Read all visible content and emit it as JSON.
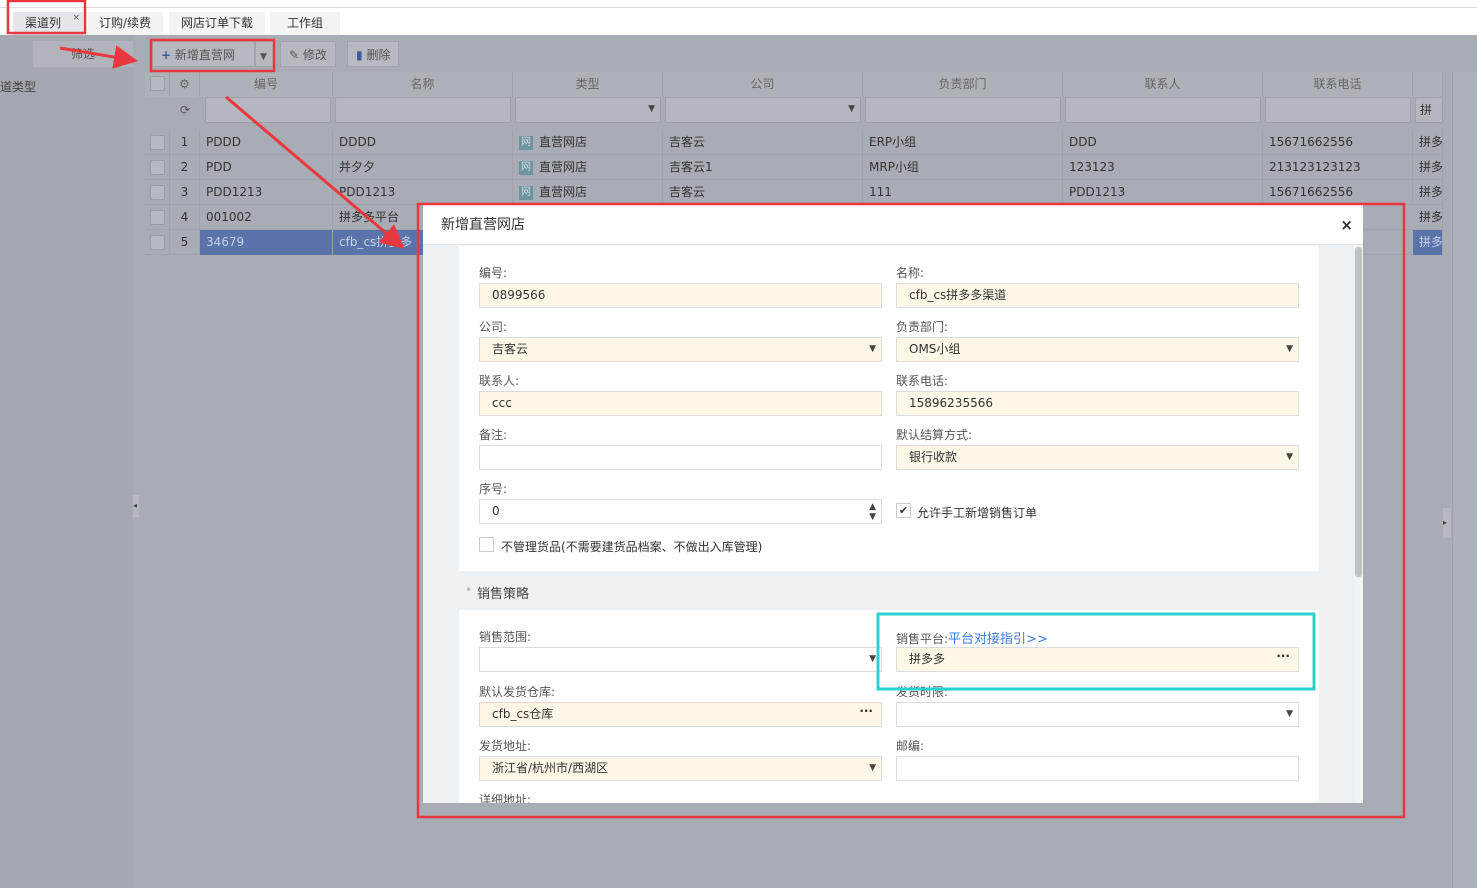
{
  "tabs": [
    {
      "label": "渠道列表",
      "close": "×"
    },
    {
      "label": "订购/续费"
    },
    {
      "label": "网店订单下载"
    },
    {
      "label": "工作组"
    }
  ],
  "sidebar": {
    "filter_button": "筛选",
    "type_label": "道类型"
  },
  "toolbar": {
    "add_label": "新增直营网店",
    "edit_label": "修改",
    "delete_label": "删除"
  },
  "grid": {
    "columns": [
      "编号",
      "名称",
      "类型",
      "公司",
      "负责部门",
      "联系人",
      "联系电话"
    ],
    "last_filter_value": "拼多",
    "rows": [
      {
        "no": "1",
        "code": "PDDD",
        "name": "DDDD",
        "type": "直营网店",
        "company": "吉客云",
        "dept": "ERP小组",
        "contact": "DDD",
        "phone": "15671662556",
        "platform": "拼多"
      },
      {
        "no": "2",
        "code": "PDD",
        "name": "并夕夕",
        "type": "直营网店",
        "company": "吉客云1",
        "dept": "MRP小组",
        "contact": "123123",
        "phone": "213123123123",
        "platform": "拼多"
      },
      {
        "no": "3",
        "code": "PDD1213",
        "name": "PDD1213",
        "type": "直营网店",
        "company": "吉客云",
        "dept": "111",
        "contact": "PDD1213",
        "phone": "15671662556",
        "platform": "拼多"
      },
      {
        "no": "4",
        "code": "001002",
        "name": "拼多多平台",
        "platform": "拼多"
      },
      {
        "no": "5",
        "code": "34679",
        "name": "cfb_cs拼多多",
        "platform": "拼多",
        "selected": true
      }
    ],
    "type_badge": "网"
  },
  "modal": {
    "title": "新增直营网店",
    "close": "×",
    "fields": {
      "code_label": "编号:",
      "code_value": "0899566",
      "name_label": "名称:",
      "name_value": "cfb_cs拼多多渠道",
      "company_label": "公司:",
      "company_value": "吉客云",
      "dept_label": "负责部门:",
      "dept_value": "OMS小组",
      "contact_label": "联系人:",
      "contact_value": "ccc",
      "phone_label": "联系电话:",
      "phone_value": "15896235566",
      "remark_label": "备注:",
      "remark_value": "",
      "settle_label": "默认结算方式:",
      "settle_value": "银行收款",
      "seq_label": "序号:",
      "seq_value": "0",
      "allow_manual_label": "允许手工新增销售订单",
      "allow_manual_checked": true,
      "no_goods_label": "不管理货品(不需要建货品档案、不做出入库管理)",
      "no_goods_checked": false
    },
    "sales": {
      "section_title": "销售策略",
      "range_label": "销售范围:",
      "range_value": "",
      "platform_label": "销售平台:",
      "platform_link": "平台对接指引>>",
      "platform_value": "拼多多",
      "warehouse_label": "默认发货仓库:",
      "warehouse_value": "cfb_cs仓库",
      "ship_time_label": "发货时限:",
      "ship_time_value": "",
      "address_label": "发货地址:",
      "address_value": "浙江省/杭州市/西湖区",
      "zip_label": "邮编:",
      "zip_value": "",
      "detail_label": "详细地址:"
    }
  },
  "colors": {
    "annotation_red": "#e8383d",
    "annotation_cyan": "#2ecfcf",
    "required_bg": "#fef6e7",
    "link": "#3b7dd8",
    "selected_row": "#5a73aa"
  }
}
